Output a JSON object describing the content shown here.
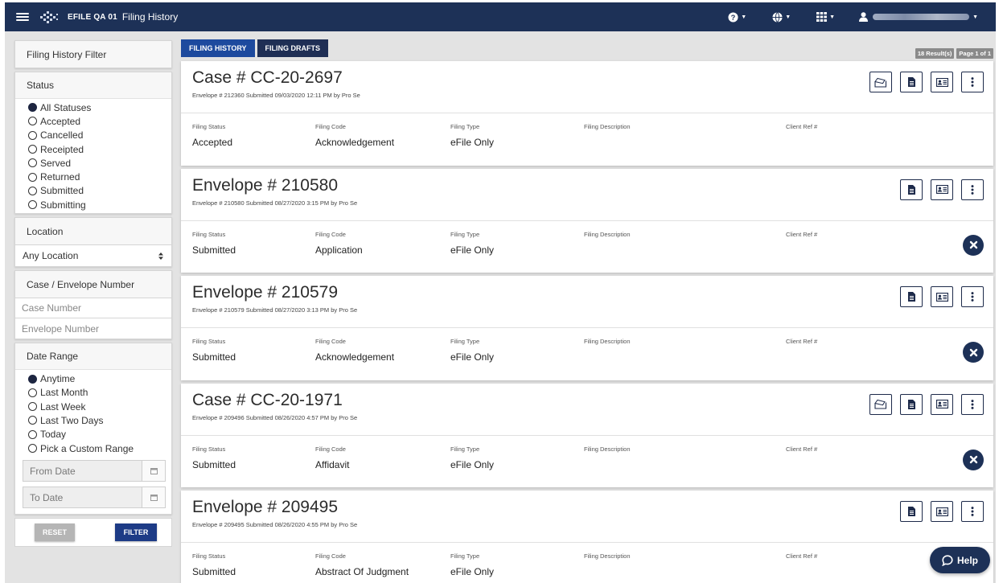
{
  "header": {
    "app_name": "EFILE QA 01",
    "page_title": "Filing History",
    "help_menu_icon": "question-circle-icon",
    "language_menu_icon": "globe-icon",
    "apps_menu_icon": "grid-icon",
    "user_menu_icon": "user-icon"
  },
  "tabs": [
    {
      "label": "FILING HISTORY",
      "active": true
    },
    {
      "label": "FILING DRAFTS",
      "active": false
    }
  ],
  "results": {
    "count": "18 Result(s)",
    "page": "Page 1 of 1"
  },
  "sidebar": {
    "filter_title": "Filing History Filter",
    "status": {
      "title": "Status",
      "options": [
        "All Statuses",
        "Accepted",
        "Cancelled",
        "Receipted",
        "Served",
        "Returned",
        "Submitted",
        "Submitting"
      ],
      "selected": "All Statuses"
    },
    "location": {
      "title": "Location",
      "selected": "Any Location"
    },
    "case_envelope": {
      "title": "Case / Envelope Number",
      "case_placeholder": "Case Number",
      "envelope_placeholder": "Envelope Number"
    },
    "date_range": {
      "title": "Date Range",
      "options": [
        "Anytime",
        "Last Month",
        "Last Week",
        "Last Two Days",
        "Today",
        "Pick a Custom Range"
      ],
      "selected": "Anytime",
      "from_placeholder": "From Date",
      "to_placeholder": "To Date"
    },
    "reset_label": "RESET",
    "filter_label": "FILTER"
  },
  "field_labels": {
    "status": "Filing Status",
    "code": "Filing Code",
    "type": "Filing Type",
    "description": "Filing Description",
    "client_ref": "Client Ref #"
  },
  "filings": [
    {
      "title": "Case # CC-20-2697",
      "subtitle": "Envelope # 212360 Submitted 09/03/2020 12:11 PM by Pro Se",
      "status": "Accepted",
      "code": "Acknowledgement",
      "type": "eFile Only",
      "description": "",
      "client_ref": "",
      "has_case_folder": true,
      "cancellable": false
    },
    {
      "title": "Envelope # 210580",
      "subtitle": "Envelope # 210580 Submitted 08/27/2020 3:15 PM by Pro Se",
      "status": "Submitted",
      "code": "Application",
      "type": "eFile Only",
      "description": "",
      "client_ref": "",
      "has_case_folder": false,
      "cancellable": true
    },
    {
      "title": "Envelope # 210579",
      "subtitle": "Envelope # 210579 Submitted 08/27/2020 3:13 PM by Pro Se",
      "status": "Submitted",
      "code": "Acknowledgement",
      "type": "eFile Only",
      "description": "",
      "client_ref": "",
      "has_case_folder": false,
      "cancellable": true
    },
    {
      "title": "Case # CC-20-1971",
      "subtitle": "Envelope # 209496 Submitted 08/26/2020 4:57 PM by Pro Se",
      "status": "Submitted",
      "code": "Affidavit",
      "type": "eFile Only",
      "description": "",
      "client_ref": "",
      "has_case_folder": true,
      "cancellable": true
    },
    {
      "title": "Envelope # 209495",
      "subtitle": "Envelope # 209495 Submitted 08/26/2020 4:55 PM by Pro Se",
      "status": "Submitted",
      "code": "Abstract Of Judgment",
      "type": "eFile Only",
      "description": "",
      "client_ref": "",
      "has_case_folder": false,
      "cancellable": false
    }
  ],
  "help_button": {
    "label": "Help",
    "icon": "chat-bubble-icon"
  }
}
